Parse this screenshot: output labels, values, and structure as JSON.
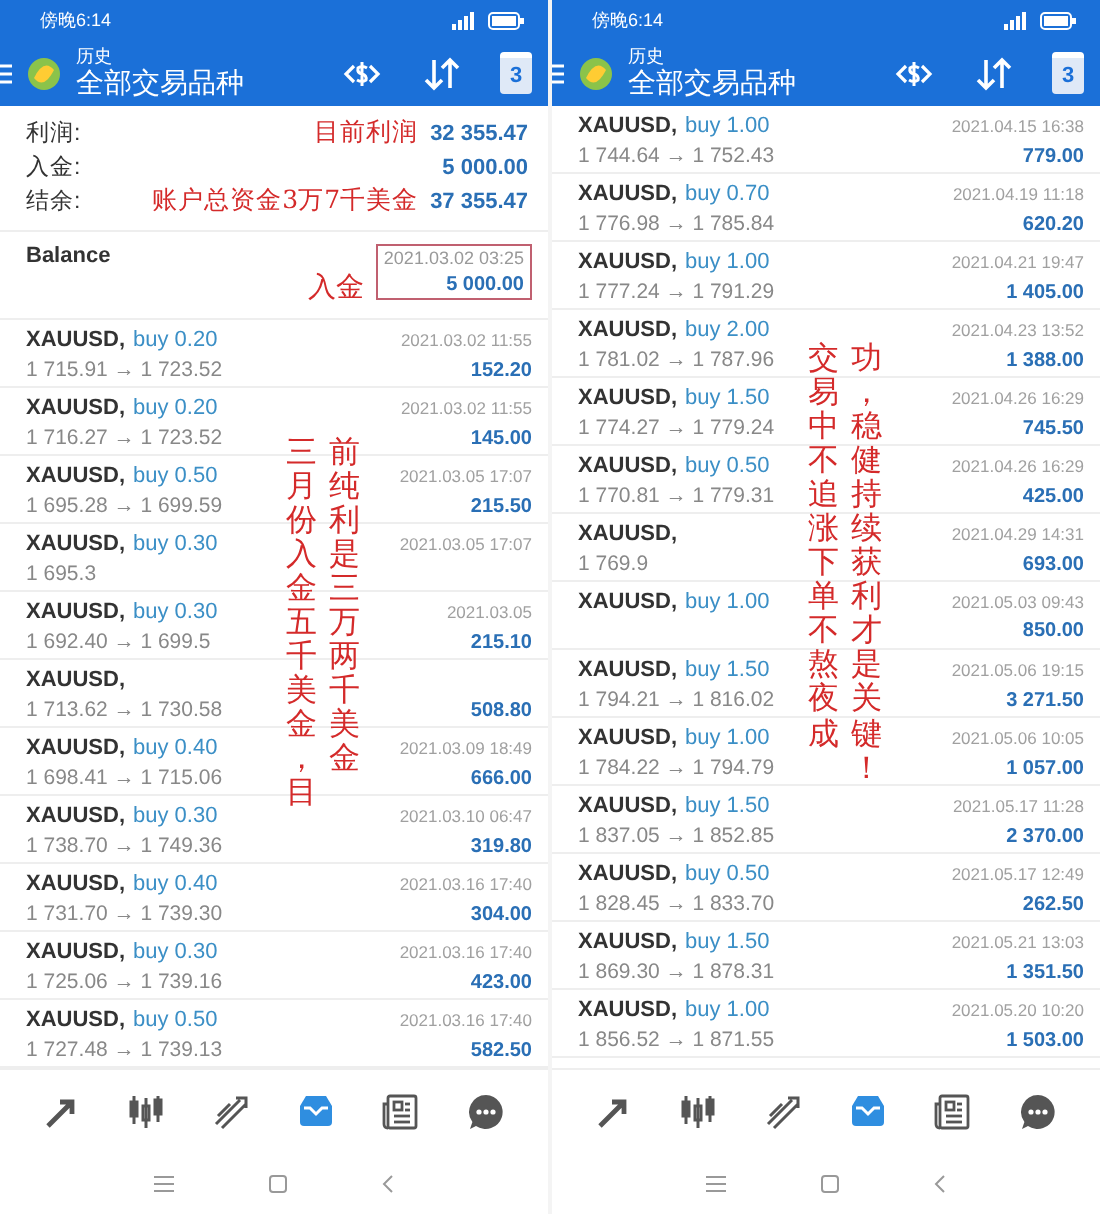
{
  "panes": [
    {
      "status": {
        "time": "傍晚6:14"
      },
      "toolbar": {
        "subtitle": "历史",
        "title": "全部交易品种",
        "calendar_day": "3"
      },
      "summary": [
        {
          "label": "利润:",
          "note": "目前利润",
          "value": "32 355.47"
        },
        {
          "label": "入金:",
          "value": "5 000.00"
        },
        {
          "label": "结余:",
          "note": "账户总资金3万7千美金",
          "value": "37 355.47"
        }
      ],
      "balance": {
        "label": "Balance",
        "note": "入金",
        "boxed": true,
        "time": "2021.03.02 03:25",
        "amount": "5 000.00"
      },
      "trades": [
        {
          "pair": "XAUUSD,",
          "side": "buy 0.20",
          "time": "2021.03.02 11:55",
          "prices": "1 715.91 → 1 723.52",
          "profit": "152.20"
        },
        {
          "pair": "XAUUSD,",
          "side": "buy 0.20",
          "time": "2021.03.02 11:55",
          "prices": "1 716.27 → 1 723.52",
          "profit": "145.00"
        },
        {
          "pair": "XAUUSD,",
          "side": "buy 0.50",
          "time": "2021.03.05 17:07",
          "prices": "1 695.28 → 1 699.59",
          "profit": "215.50"
        },
        {
          "pair": "XAUUSD,",
          "side": "buy 0.30",
          "time": "2021.03.05 17:07",
          "prices": "1 695.3"
        },
        {
          "pair": "XAUUSD,",
          "side": "buy 0.30",
          "time": "2021.03.05",
          "prices": "1 692.40 → 1 699.5",
          "profit": "215.10"
        },
        {
          "pair": "XAUUSD,",
          "prices": "1 713.62 → 1 730.58",
          "profit": "508.80"
        },
        {
          "pair": "XAUUSD,",
          "side": "buy 0.40",
          "time": "2021.03.09 18:49",
          "prices": "1 698.41 → 1 715.06",
          "profit": "666.00"
        },
        {
          "pair": "XAUUSD,",
          "side": "buy 0.30",
          "time": "2021.03.10 06:47",
          "prices": "1 738.70 → 1 749.36",
          "profit": "319.80"
        },
        {
          "pair": "XAUUSD,",
          "side": "buy 0.40",
          "time": "2021.03.16 17:40",
          "prices": "1 731.70 → 1 739.30",
          "profit": "304.00"
        },
        {
          "pair": "XAUUSD,",
          "side": "buy 0.30",
          "time": "2021.03.16 17:40",
          "prices": "1 725.06 → 1 739.16",
          "profit": "423.00"
        },
        {
          "pair": "XAUUSD,",
          "side": "buy 0.50",
          "time": "2021.03.16 17:40",
          "prices": "1 727.48 → 1 739.13",
          "profit": "582.50"
        }
      ],
      "vertical_notes": [
        "三月份入金五千美金，目",
        "前纯利是三万两千美金"
      ],
      "nav": [
        {
          "selected": false
        },
        {
          "selected": false
        },
        {
          "selected": false
        },
        {
          "selected": true
        },
        {
          "selected": false
        },
        {
          "selected": false
        }
      ]
    },
    {
      "status": {
        "time": "傍晚6:14"
      },
      "toolbar": {
        "subtitle": "历史",
        "title": "全部交易品种",
        "calendar_day": "3"
      },
      "trades": [
        {
          "pair": "XAUUSD,",
          "side": "buy 1.00",
          "time": "2021.04.15 16:38",
          "prices": "1 744.64 → 1 752.43",
          "profit": "779.00"
        },
        {
          "pair": "XAUUSD,",
          "side": "buy 0.70",
          "time": "2021.04.19 11:18",
          "prices": "1 776.98 → 1 785.84",
          "profit": "620.20"
        },
        {
          "pair": "XAUUSD,",
          "side": "buy 1.00",
          "time": "2021.04.21 19:47",
          "prices": "1 777.24 → 1 791.29",
          "profit": "1 405.00"
        },
        {
          "pair": "XAUUSD,",
          "side": "buy 2.00",
          "time": "2021.04.23 13:52",
          "prices": "1 781.02 → 1 787.96",
          "profit": "1 388.00"
        },
        {
          "pair": "XAUUSD,",
          "side": "buy 1.50",
          "time": "2021.04.26 16:29",
          "prices": "1 774.27 → 1 779.24",
          "profit": "745.50"
        },
        {
          "pair": "XAUUSD,",
          "side": "buy 0.50",
          "time": "2021.04.26 16:29",
          "prices": "1 770.81 → 1 779.31",
          "profit": "425.00"
        },
        {
          "pair": "XAUUSD,",
          "time": "2021.04.29 14:31",
          "prices": "1 769.9",
          "profit": "693.00"
        },
        {
          "pair": "XAUUSD,",
          "side": "buy 1.00",
          "time": "2021.05.03 09:43",
          "profit": "850.00"
        },
        {
          "pair": "XAUUSD,",
          "side": "buy 1.50",
          "time": "2021.05.06 19:15",
          "prices": "1 794.21 → 1 816.02",
          "profit": "3 271.50"
        },
        {
          "pair": "XAUUSD,",
          "side": "buy 1.00",
          "time": "2021.05.06 10:05",
          "prices": "1 784.22 → 1 794.79",
          "profit": "1 057.00"
        },
        {
          "pair": "XAUUSD,",
          "side": "buy 1.50",
          "time": "2021.05.17 11:28",
          "prices": "1 837.05 → 1 852.85",
          "profit": "2 370.00"
        },
        {
          "pair": "XAUUSD,",
          "side": "buy 0.50",
          "time": "2021.05.17 12:49",
          "prices": "1 828.45 → 1 833.70",
          "profit": "262.50"
        },
        {
          "pair": "XAUUSD,",
          "side": "buy 1.50",
          "time": "2021.05.21 13:03",
          "prices": "1 869.30 → 1 878.31",
          "profit": "1 351.50"
        },
        {
          "pair": "XAUUSD,",
          "side": "buy 1.00",
          "time": "2021.05.20 10:20",
          "prices": "1 856.52 → 1 871.55",
          "profit": "1 503.00"
        }
      ],
      "vertical_notes": [
        "交易中不追涨下单不熬夜成",
        "功，稳健持续获利才是关键！"
      ],
      "nav": [
        {
          "selected": false
        },
        {
          "selected": false
        },
        {
          "selected": false
        },
        {
          "selected": true
        },
        {
          "selected": false
        },
        {
          "selected": false
        }
      ]
    }
  ]
}
